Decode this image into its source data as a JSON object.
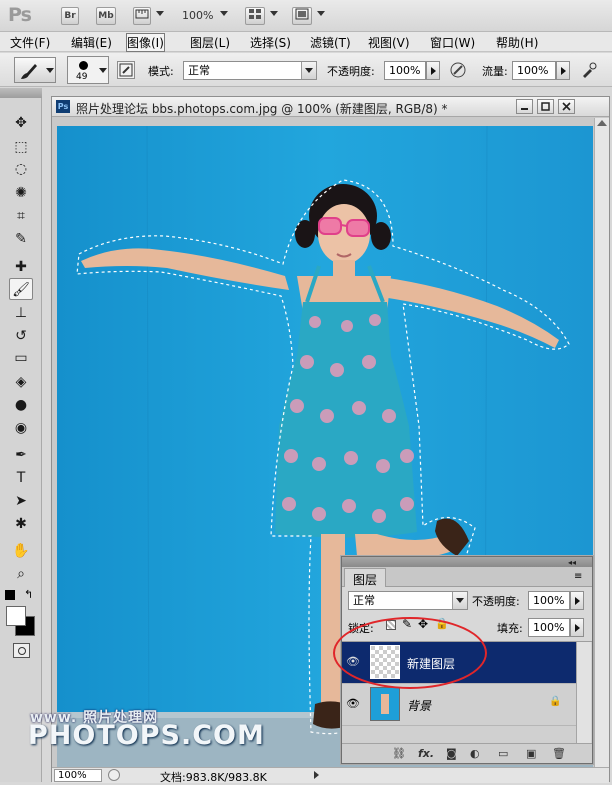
{
  "app": {
    "logo": "Ps",
    "bridge_label": "Br",
    "minibridge_label": "Mb",
    "zoom": "100%"
  },
  "menu": [
    "文件(F)",
    "编辑(E)",
    "图像(I)",
    "图层(L)",
    "选择(S)",
    "滤镜(T)",
    "视图(V)",
    "窗口(W)",
    "帮助(H)"
  ],
  "options": {
    "brush_size": "49",
    "mode_label": "模式:",
    "mode_value": "正常",
    "opacity_label": "不透明度:",
    "opacity_value": "100%",
    "flow_label": "流量:",
    "flow_value": "100%"
  },
  "document": {
    "icon_label": "Ps",
    "title": "照片处理论坛 bbs.photops.com.jpg @ 100% (新建图层, RGB/8) *",
    "zoom": "100%",
    "status": "文档:983.8K/983.8K"
  },
  "layers_panel": {
    "tab": "图层",
    "blend_mode": "正常",
    "opacity_label": "不透明度:",
    "opacity_value": "100%",
    "lock_label": "锁定:",
    "fill_label": "填充:",
    "fill_value": "100%",
    "layers": [
      {
        "name": "新建图层",
        "selected": true
      },
      {
        "name": "背景",
        "selected": false,
        "locked": true
      }
    ]
  },
  "watermark": {
    "line1": "www. 照片处理网",
    "line2": "PHOTOPS.COM"
  },
  "colors": {
    "canvas_blue": "#1e9fd8",
    "selection_highlight": "#0d2a6e",
    "annotation_red": "#e0262a"
  }
}
